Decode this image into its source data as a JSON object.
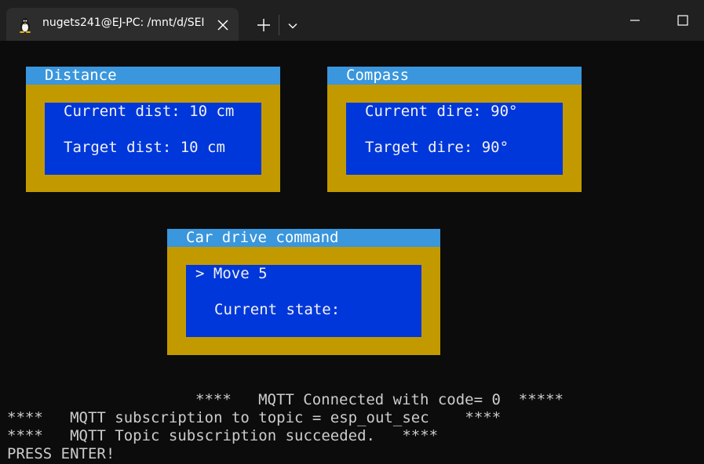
{
  "window": {
    "tab_title": "nugets241@EJ-PC: /mnt/d/SEI",
    "icons": {
      "tab": "linux-penguin-icon",
      "close": "close-icon",
      "new_tab": "plus-icon",
      "dropdown": "chevron-down-icon",
      "minimize": "minimize-icon",
      "maximize": "maximize-icon"
    }
  },
  "colors": {
    "terminal_bg": "#0c0c0c",
    "panel_frame": "#c29a00",
    "panel_header": "#3a96dd",
    "panel_body": "#0037da",
    "text": "#f2f2f2"
  },
  "panels": {
    "distance": {
      "title": "Distance",
      "current": "Current dist: 10 cm",
      "target": "Target dist: 10 cm"
    },
    "compass": {
      "title": "Compass",
      "current": "Current dire: 90°",
      "target": "Target dire: 90°"
    },
    "car": {
      "title": "Car drive command",
      "command": "> Move 5",
      "state": "Current state:"
    }
  },
  "console": {
    "line1": "****   MQTT Connected with code= 0  *****",
    "line2": "****   MQTT subscription to topic = esp_out_sec    ****",
    "line3": "****   MQTT Topic subscription succeeded.   ****",
    "line4": "PRESS ENTER!"
  }
}
